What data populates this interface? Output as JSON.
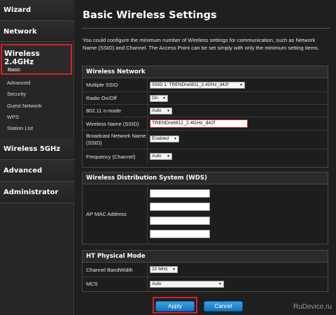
{
  "sidebar": {
    "wizard": "Wizard",
    "network": "Network",
    "wireless24": "Wireless 2.4GHz",
    "items": [
      "Basic",
      "Advanced",
      "Security",
      "Guest Network",
      "WPS",
      "Station List"
    ],
    "wireless5": "Wireless 5GHz",
    "advanced": "Advanced",
    "administrator": "Administrator"
  },
  "main": {
    "title": "Basic Wireless Settings",
    "description": "You could configure the minimum number of Wireless settings for communication, such as Network Name (SSID) and Channel. The Access Point can be set simply with only the minimum setting items."
  },
  "wireless_network": {
    "header": "Wireless Network",
    "multiple_ssid_label": "Multiple SSID",
    "multiple_ssid_value": "SSID 1: TRENDnet811_2.4GHz_d42f",
    "radio_label": "Radio On/Off",
    "radio_value": "On",
    "mode_label": "802.11 n-mode",
    "mode_value": "Auto",
    "name_label": "Wireless Name (SSID)",
    "name_value": "TRENDnet811_2.4GHz_d42f",
    "broadcast_label": "Broadcast Network Name (SSID)",
    "broadcast_value": "Enabled",
    "channel_label": "Frequency (Channel)",
    "channel_value": "Auto"
  },
  "wds": {
    "header": "Wireless Distribution System (WDS)",
    "mac_label": "AP MAC Address"
  },
  "ht": {
    "header": "HT Physical Mode",
    "bw_label": "Channel BandWidth",
    "bw_value": "20 MHz",
    "mcs_label": "MCS",
    "mcs_value": "Auto"
  },
  "buttons": {
    "apply": "Apply",
    "cancel": "Cancel"
  },
  "watermark": "RuDevice.ru",
  "colors": {
    "highlight": "#d2232a",
    "button": "#1a82d0"
  }
}
